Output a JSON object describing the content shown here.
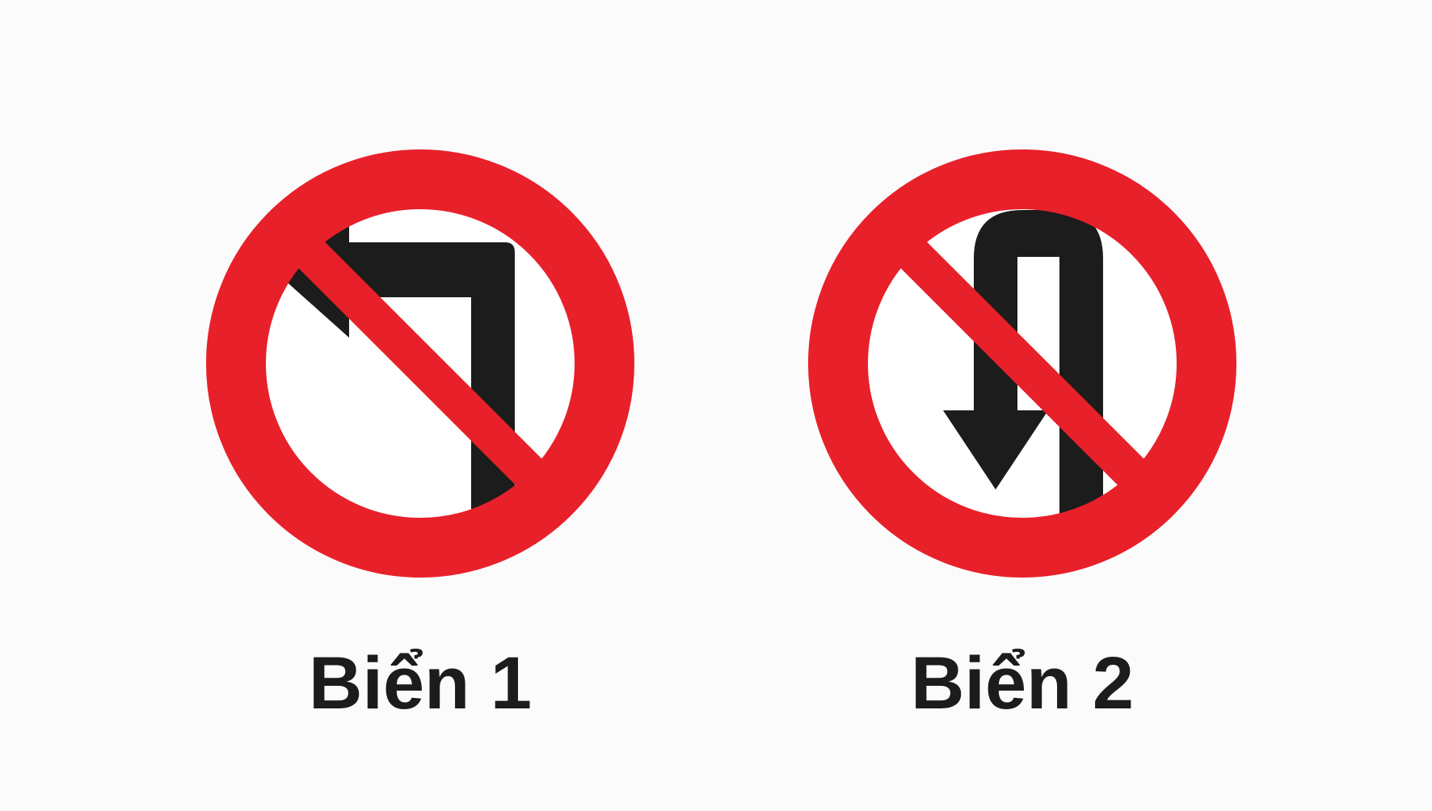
{
  "signs": [
    {
      "caption": "Biển 1",
      "icon": "no-left-turn-icon"
    },
    {
      "caption": "Biển 2",
      "icon": "no-u-turn-icon"
    }
  ],
  "colors": {
    "ring": "#e8202a",
    "symbol": "#1c1c1c",
    "face": "#ffffff",
    "background": "#fbfbfb"
  }
}
